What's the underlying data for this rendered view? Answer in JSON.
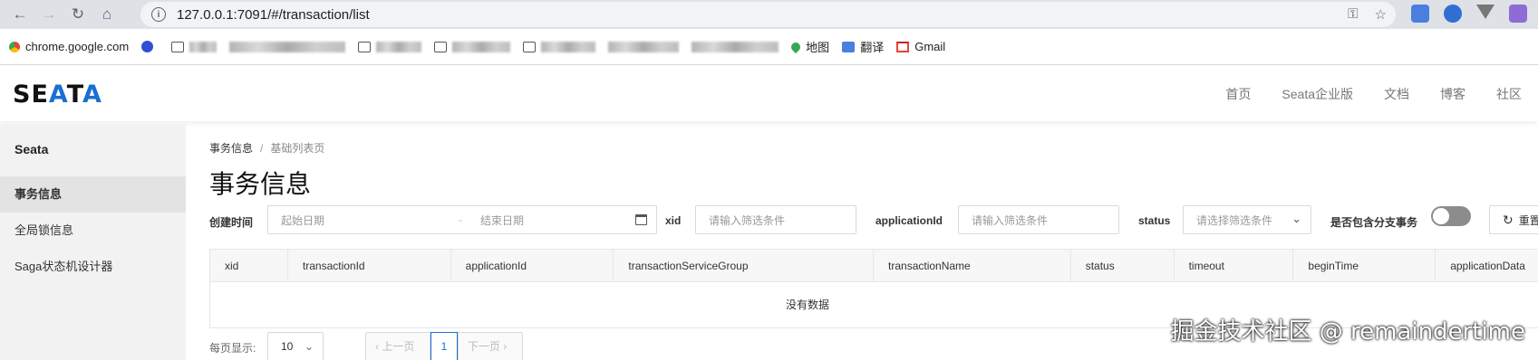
{
  "browser": {
    "url": "127.0.0.1:7091/#/transaction/list",
    "bookmarks": [
      {
        "label": "chrome.google.com"
      },
      {
        "label": "地图"
      },
      {
        "label": "翻译"
      },
      {
        "label": "Gmail"
      }
    ]
  },
  "header": {
    "logo": "SEATA",
    "nav": [
      "首页",
      "Seata企业版",
      "文档",
      "博客",
      "社区"
    ]
  },
  "sidebar": {
    "title": "Seata",
    "items": [
      {
        "label": "事务信息",
        "active": true
      },
      {
        "label": "全局锁信息",
        "active": false
      },
      {
        "label": "Saga状态机设计器",
        "active": false
      }
    ]
  },
  "main": {
    "breadcrumb": [
      "事务信息",
      "基础列表页"
    ],
    "title": "事务信息",
    "filters": {
      "create_time_label": "创建时间",
      "start_placeholder": "起始日期",
      "end_placeholder": "结束日期",
      "range_sep": "-",
      "xid_label": "xid",
      "xid_placeholder": "请输入筛选条件",
      "app_label": "applicationId",
      "app_placeholder": "请输入筛选条件",
      "status_label": "status",
      "status_placeholder": "请选择筛选条件",
      "branch_label": "是否包含分支事务",
      "reset_label": "重置"
    },
    "table": {
      "columns": [
        "xid",
        "transactionId",
        "applicationId",
        "transactionServiceGroup",
        "transactionName",
        "status",
        "timeout",
        "beginTime",
        "applicationData"
      ],
      "empty_text": "没有数据"
    },
    "pager": {
      "page_size_label": "每页显示:",
      "page_size": "10",
      "prev": "上一页",
      "current": "1",
      "next": "下一页"
    }
  },
  "watermark": "掘金技术社区 @ remaindertime"
}
